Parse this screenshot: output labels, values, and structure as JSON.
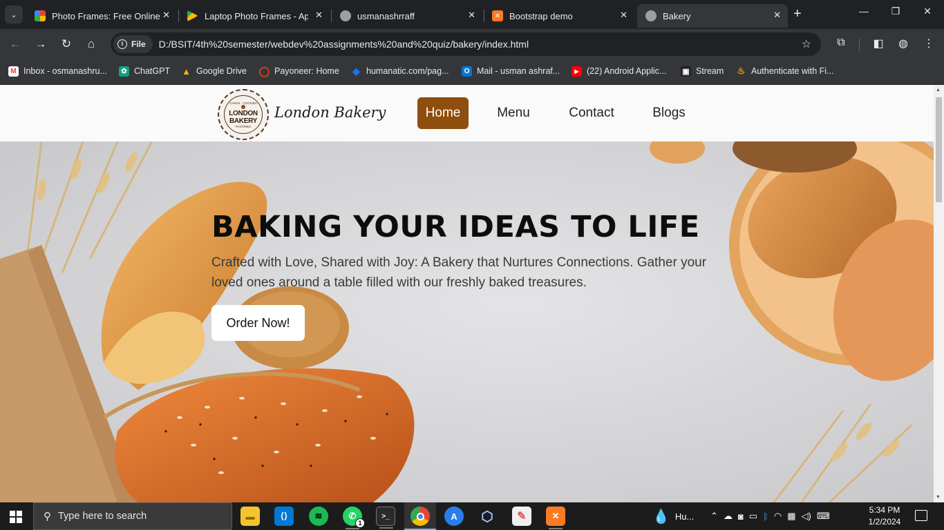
{
  "browser": {
    "tabs": [
      {
        "title": "Photo Frames: Free Online P",
        "close": "✕"
      },
      {
        "title": "Laptop Photo Frames - App",
        "close": "✕"
      },
      {
        "title": "usmanashrraff",
        "close": "✕"
      },
      {
        "title": "Bootstrap demo",
        "close": "✕"
      },
      {
        "title": "Bakery",
        "close": "✕"
      }
    ],
    "new_tab": "+",
    "window_controls": {
      "minimize": "—",
      "maximize": "❐",
      "close": "✕"
    },
    "address": {
      "chip_label": "File",
      "url": "D:/BSIT/4th%20semester/webdev%20assignments%20and%20quiz/bakery/index.html"
    },
    "bookmarks": [
      {
        "label": "Inbox - osmanashru...",
        "color": "#ea4335",
        "glyph": "M"
      },
      {
        "label": "ChatGPT",
        "color": "#10a37f",
        "glyph": "✿"
      },
      {
        "label": "Google Drive",
        "color": "#fbbc04",
        "glyph": "▲"
      },
      {
        "label": "Payoneer: Home",
        "color": "#ff4800",
        "glyph": "◯"
      },
      {
        "label": "humanatic.com/pag...",
        "color": "#1a73e8",
        "glyph": "◆"
      },
      {
        "label": "Mail - usman ashraf...",
        "color": "#0078d4",
        "glyph": "O"
      },
      {
        "label": "(22) Android Applic...",
        "color": "#ff0000",
        "glyph": "▶"
      },
      {
        "label": "Stream",
        "color": "#5f6368",
        "glyph": "▣"
      },
      {
        "label": "Authenticate with Fi...",
        "color": "#ffa000",
        "glyph": "♨"
      }
    ]
  },
  "site": {
    "brand": "London Bakery",
    "logo": {
      "line1": "LONDON",
      "line2": "BAKERY",
      "ring_top": "CAKES · COOKIES",
      "ring_bottom": "PASTRIES"
    },
    "nav": [
      {
        "label": "Home",
        "active": true
      },
      {
        "label": "Menu",
        "active": false
      },
      {
        "label": "Contact",
        "active": false
      },
      {
        "label": "Blogs",
        "active": false
      }
    ],
    "hero": {
      "title": "BAKING YOUR IDEAS TO LIFE",
      "subtitle": "Crafted with Love, Shared with Joy: A Bakery that Nurtures Connections. Gather your loved ones around a table filled with our freshly baked treasures.",
      "button": "Order Now!"
    },
    "accent_color": "#8f4e0d"
  },
  "taskbar": {
    "search_placeholder": "Type here to search",
    "apps": [
      {
        "name": "File Explorer",
        "color": "#f4c430",
        "glyph": "▬"
      },
      {
        "name": "VS Code",
        "color": "#0078d4",
        "glyph": "⟨⟩"
      },
      {
        "name": "Spotify",
        "color": "#1db954",
        "glyph": "≋"
      },
      {
        "name": "WhatsApp",
        "color": "#25d366",
        "glyph": "✆",
        "badge": "1"
      },
      {
        "name": "Terminal",
        "color": "#3a3a3a",
        "glyph": ">_"
      },
      {
        "name": "Chrome",
        "color": "#4285f4",
        "glyph": "◉"
      },
      {
        "name": "App Store",
        "color": "#2b7de9",
        "glyph": "A"
      },
      {
        "name": "VirtualBox",
        "color": "#2f6db5",
        "glyph": "⬡"
      },
      {
        "name": "Paint",
        "color": "#e35b5b",
        "glyph": "✎"
      },
      {
        "name": "XAMPP",
        "color": "#fb7a24",
        "glyph": "✕"
      }
    ],
    "weather_label": "Hu...",
    "time": "5:34 PM",
    "date": "1/2/2024"
  }
}
